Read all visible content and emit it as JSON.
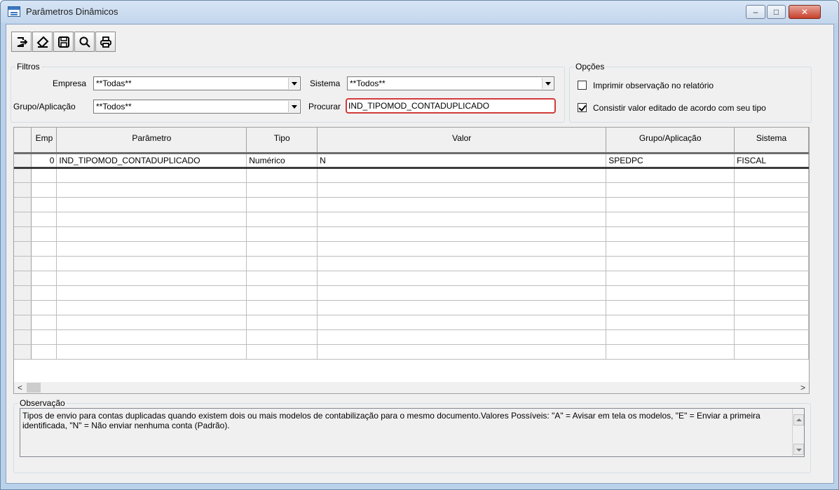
{
  "window": {
    "title": "Parâmetros Dinâmicos",
    "minimize_label": "–",
    "maximize_label": "□",
    "close_label": "✕"
  },
  "toolbar": {
    "buttons": [
      {
        "name": "exit-icon"
      },
      {
        "name": "eraser-icon"
      },
      {
        "name": "save-icon"
      },
      {
        "name": "search-icon"
      },
      {
        "name": "print-icon"
      }
    ]
  },
  "filters": {
    "legend": "Filtros",
    "empresa_label": "Empresa",
    "empresa_value": "**Todas**",
    "sistema_label": "Sistema",
    "sistema_value": "**Todos**",
    "grupo_label": "Grupo/Aplicação",
    "grupo_value": "**Todos**",
    "procurar_label": "Procurar",
    "procurar_value": "IND_TIPOMOD_CONTADUPLICADO"
  },
  "options": {
    "legend": "Opções",
    "imprimir_label": "Imprimir observação no relatório",
    "imprimir_checked": false,
    "consistir_label": "Consistir valor editado de acordo com seu tipo",
    "consistir_checked": true
  },
  "grid": {
    "columns": [
      "Emp",
      "Parâmetro",
      "Tipo",
      "Valor",
      "Grupo/Aplicação",
      "Sistema"
    ],
    "rows": [
      [
        "0",
        "IND_TIPOMOD_CONTADUPLICADO",
        "Numérico",
        "N",
        "SPEDPC",
        "FISCAL"
      ]
    ],
    "empty_rows": 13
  },
  "scroll": {
    "left_label": "<",
    "right_label": ">"
  },
  "observacao": {
    "legend": "Observação",
    "text": "Tipos de envio para contas duplicadas quando existem dois ou mais modelos de contabilização para o mesmo documento.Valores Possíveis: \"A\" = Avisar em tela os modelos, \"E\" = Enviar a primeira identificada, \"N\" = Não enviar nenhuma conta (Padrão)."
  }
}
